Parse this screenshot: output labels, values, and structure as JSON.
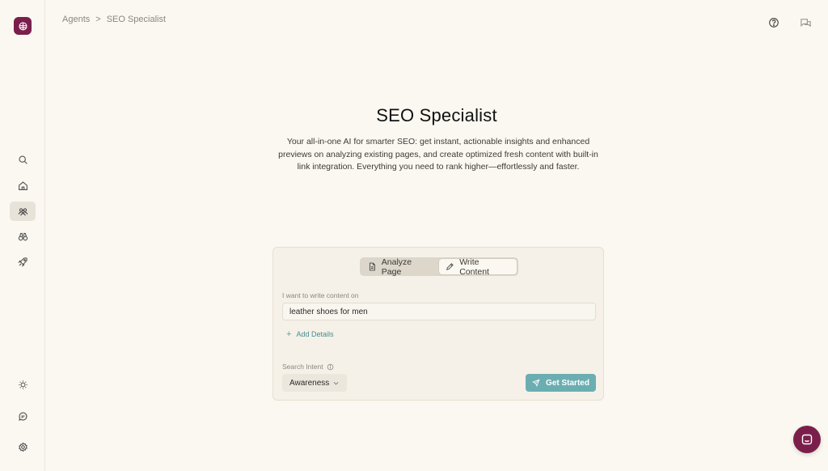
{
  "breadcrumb": {
    "parent": "Agents",
    "separator": ">",
    "current": "SEO Specialist"
  },
  "hero": {
    "title": "SEO Specialist",
    "description": "Your all-in-one AI for smarter SEO: get instant, actionable insights and enhanced previews on analyzing existing pages, and create optimized fresh content with built-in link integration. Everything you need to rank higher—effortlessly and faster."
  },
  "form": {
    "tabs": [
      {
        "label": "Analyze Page",
        "icon": "document-icon",
        "active": false
      },
      {
        "label": "Write Content",
        "icon": "pen-icon",
        "active": true
      }
    ],
    "topic_label": "I want to write content on",
    "topic_value": "leather shoes for men",
    "add_details": "Add Details",
    "intent_label": "Search Intent",
    "intent_value": "Awareness",
    "submit_label": "Get Started"
  },
  "sidebar": {
    "items": [
      {
        "icon": "search-icon",
        "active": false
      },
      {
        "icon": "home-icon",
        "active": false
      },
      {
        "icon": "agents-icon",
        "active": true
      },
      {
        "icon": "binoculars-icon",
        "active": false
      },
      {
        "icon": "rocket-icon",
        "active": false
      }
    ],
    "bottom": [
      "sun-icon",
      "chat-icon",
      "settings-icon"
    ]
  },
  "colors": {
    "brand": "#7a1f4b",
    "accent": "#6baeb2",
    "background": "#fbf8f1"
  }
}
